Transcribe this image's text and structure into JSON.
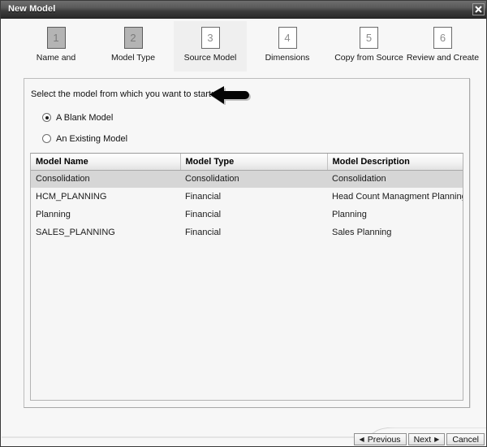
{
  "window": {
    "title": "New Model",
    "close_icon": "close-icon"
  },
  "steps": [
    {
      "num": "1",
      "label": "Name and",
      "state": "done"
    },
    {
      "num": "2",
      "label": "Model Type",
      "state": "done"
    },
    {
      "num": "3",
      "label": "Source Model",
      "state": "active"
    },
    {
      "num": "4",
      "label": "Dimensions",
      "state": "todo"
    },
    {
      "num": "5",
      "label": "Copy from Source",
      "state": "todo"
    },
    {
      "num": "6",
      "label": "Review and Create",
      "state": "todo"
    }
  ],
  "main": {
    "prompt": "Select the model from which you want to start:",
    "annotation_icon": "left-arrow-annotation-icon",
    "options": [
      {
        "label": "A Blank Model",
        "selected": true
      },
      {
        "label": "An Existing Model",
        "selected": false
      }
    ],
    "table": {
      "columns": [
        "Model Name",
        "Model Type",
        "Model Description"
      ],
      "rows": [
        {
          "name": "Consolidation",
          "type": "Consolidation",
          "description": "Consolidation",
          "selected": true
        },
        {
          "name": "HCM_PLANNING",
          "type": "Financial",
          "description": "Head Count Managment Planning",
          "selected": false
        },
        {
          "name": "Planning",
          "type": "Financial",
          "description": "Planning",
          "selected": false
        },
        {
          "name": "SALES_PLANNING",
          "type": "Financial",
          "description": "Sales Planning",
          "selected": false
        }
      ]
    }
  },
  "footer": {
    "previous_label": "Previous",
    "next_label": "Next",
    "cancel_label": "Cancel",
    "prev_icon": "triangle-left-icon",
    "next_icon": "triangle-right-icon"
  },
  "colors": {
    "titlebar_dark": "#2a2a2a",
    "panel_bg": "#f7f7f7",
    "row_selected": "#d6d6d6",
    "step_done": "#b4b4b4"
  }
}
